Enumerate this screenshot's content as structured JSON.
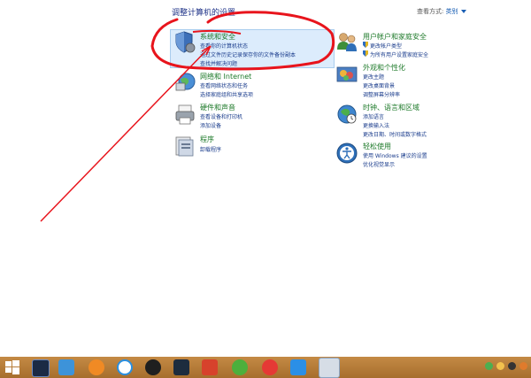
{
  "header": {
    "title": "调整计算机的设置",
    "view_by_label": "查看方式:",
    "view_by_value": "类别"
  },
  "categories": {
    "system_security": {
      "title": "系统和安全",
      "links": [
        "查看你的计算机状态",
        "通过文件历史记录保存你的文件备份副本",
        "查找并解决问题"
      ]
    },
    "network": {
      "title": "网络和 Internet",
      "links": [
        "查看网络状态和任务",
        "选择家庭组和共享选项"
      ]
    },
    "hardware": {
      "title": "硬件和声音",
      "links": [
        "查看设备和打印机",
        "添加设备"
      ]
    },
    "programs": {
      "title": "程序",
      "links": [
        "卸载程序"
      ]
    },
    "user_accounts": {
      "title": "用户帐户和家庭安全",
      "links": [
        "更改帐户类型",
        "为所有用户设置家庭安全"
      ]
    },
    "appearance": {
      "title": "外观和个性化",
      "links": [
        "更改主题",
        "更改桌面背景",
        "调整屏幕分辨率"
      ]
    },
    "clock_region": {
      "title": "时钟、语言和区域",
      "links": [
        "添加语言",
        "更换输入法",
        "更改日期、时间或数字格式"
      ]
    },
    "ease_of_access": {
      "title": "轻松使用",
      "links": [
        "使用 Windows 建议的设置",
        "优化视觉显示"
      ]
    }
  },
  "annotation_color": "#e8141c",
  "taskbar": {
    "background": "#b87c3a",
    "apps": [
      "start-icon",
      "app-icon-1",
      "app-icon-2",
      "app-icon-3",
      "app-icon-4",
      "qq-icon",
      "app-icon-6",
      "app-icon-7",
      "app-icon-8",
      "media-icon",
      "app-icon-10",
      "control-panel-icon"
    ]
  }
}
